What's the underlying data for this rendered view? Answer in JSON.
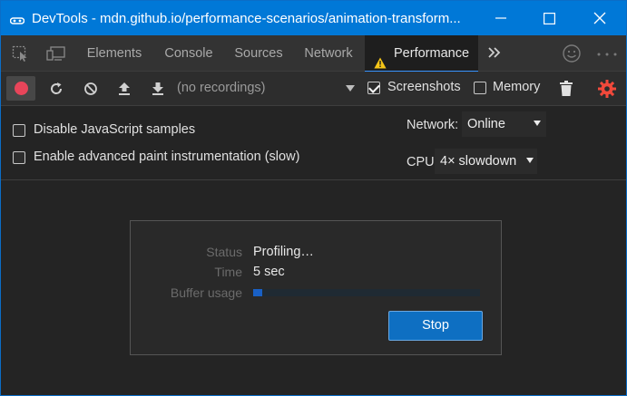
{
  "window": {
    "title": "DevTools - mdn.github.io/performance-scenarios/animation-transform..."
  },
  "tabs": [
    {
      "label": "Elements"
    },
    {
      "label": "Console"
    },
    {
      "label": "Sources"
    },
    {
      "label": "Network"
    },
    {
      "label": "Performance",
      "active": true,
      "icon": "warning-icon"
    }
  ],
  "toolbar": {
    "recordings_placeholder": "(no recordings)",
    "screenshots_label": "Screenshots",
    "screenshots_checked": true,
    "memory_label": "Memory",
    "memory_checked": false
  },
  "settings": {
    "disable_js_samples_label": "Disable JavaScript samples",
    "disable_js_samples_checked": false,
    "paint_instrumentation_label": "Enable advanced paint instrumentation (slow)",
    "paint_instrumentation_checked": false,
    "network_label": "Network:",
    "network_value": "Online",
    "cpu_label": "CPU:",
    "cpu_value": "4× slowdown"
  },
  "status_dialog": {
    "status_label": "Status",
    "status_value": "Profiling…",
    "time_label": "Time",
    "time_value": "5 sec",
    "buffer_label": "Buffer usage",
    "buffer_usage_fraction": 0.04,
    "stop_label": "Stop"
  },
  "colors": {
    "titlebar": "#0078d7",
    "accent": "#3794ff",
    "record": "#e8455a",
    "settings_gear": "#f2493b",
    "warning": "#f5c518",
    "stop_button": "#0e6fc2"
  }
}
